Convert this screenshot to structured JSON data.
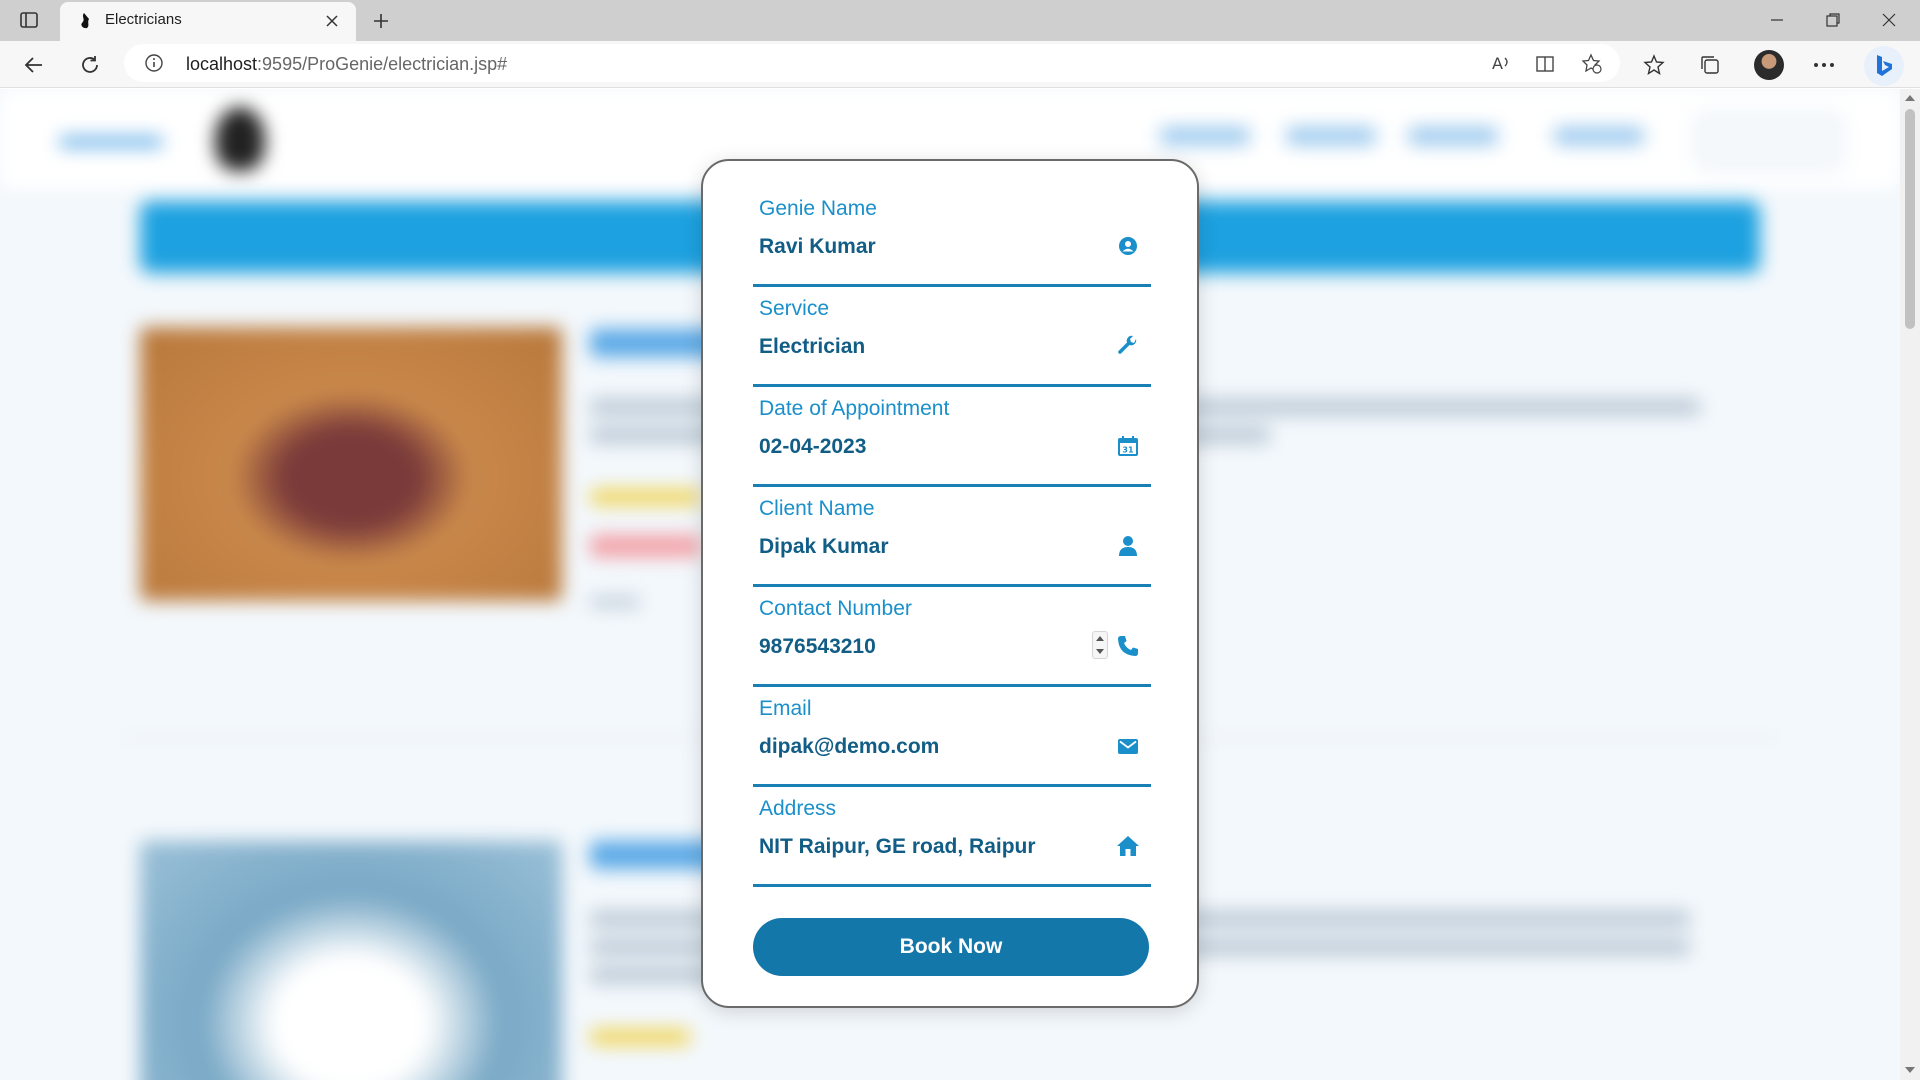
{
  "browser": {
    "tab_title": "Electricians",
    "url_host": "localhost",
    "url_path": ":9595/ProGenie/electrician.jsp#"
  },
  "form": {
    "fields": [
      {
        "label": "Genie Name",
        "value": "Ravi Kumar",
        "icon": "user-circle-icon"
      },
      {
        "label": "Service",
        "value": "Electrician",
        "icon": "wrench-icon"
      },
      {
        "label": "Date of Appointment",
        "value": "02-04-2023",
        "icon": "calendar-icon"
      },
      {
        "label": "Client Name",
        "value": "Dipak Kumar",
        "icon": "person-icon"
      },
      {
        "label": "Contact Number",
        "value": "9876543210",
        "icon": "phone-icon"
      },
      {
        "label": "Email",
        "value": "dipak@demo.com",
        "icon": "envelope-icon"
      },
      {
        "label": "Address",
        "value": "NIT Raipur, GE road, Raipur",
        "icon": "home-icon"
      }
    ],
    "submit_label": "Book Now"
  },
  "colors": {
    "accent": "#1a8fca",
    "value_text": "#125d86",
    "button": "#1477aa"
  }
}
